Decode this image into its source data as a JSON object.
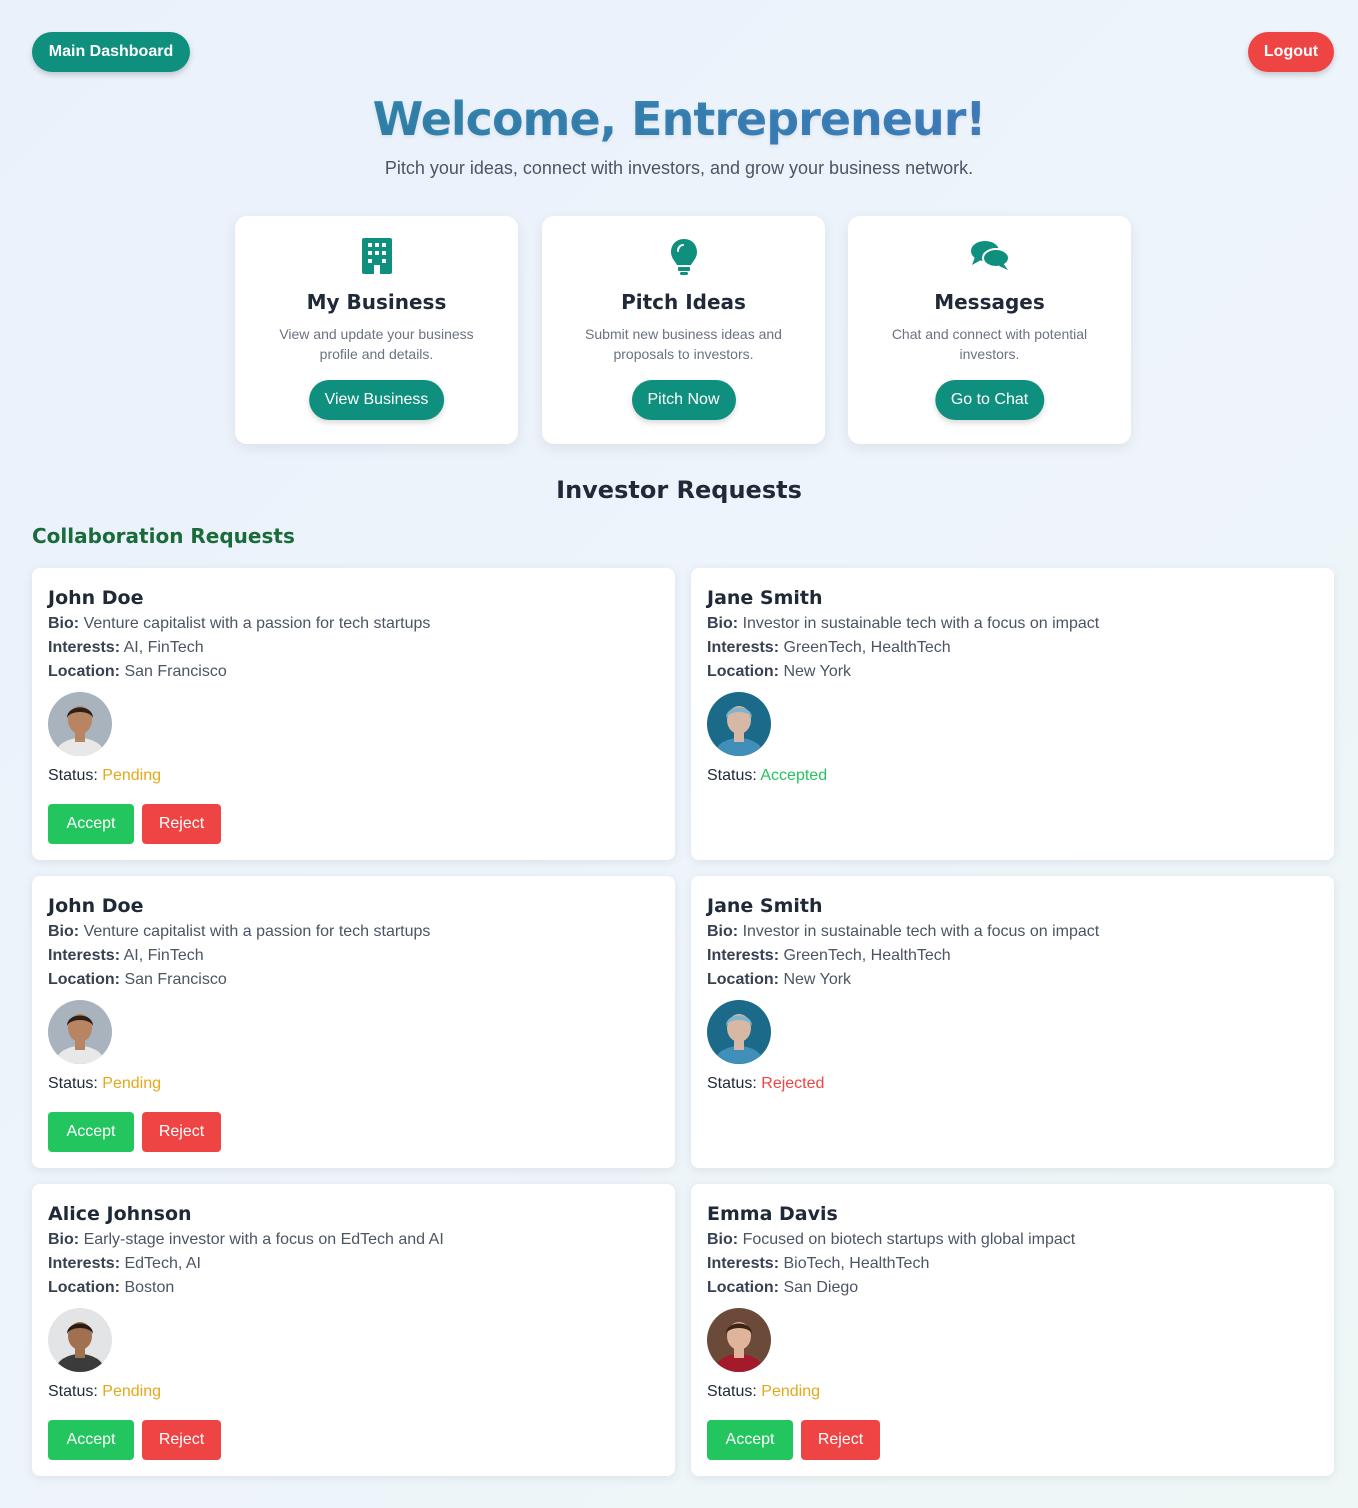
{
  "nav": {
    "dashboard_label": "Main Dashboard",
    "logout_label": "Logout"
  },
  "header": {
    "title": "Welcome, Entrepreneur!",
    "subtitle": "Pitch your ideas, connect with investors, and grow your business network."
  },
  "features": [
    {
      "icon": "building-icon",
      "title": "My Business",
      "description": "View and update your business profile and details.",
      "button": "View Business"
    },
    {
      "icon": "lightbulb-icon",
      "title": "Pitch Ideas",
      "description": "Submit new business ideas and proposals to investors.",
      "button": "Pitch Now"
    },
    {
      "icon": "chat-bubbles-icon",
      "title": "Messages",
      "description": "Chat and connect with potential investors.",
      "button": "Go to Chat"
    }
  ],
  "section_title": "Investor Requests",
  "collab_title": "Collaboration Requests",
  "labels": {
    "bio": "Bio:",
    "interests": "Interests:",
    "location": "Location:",
    "status": "Status:",
    "accept": "Accept",
    "reject": "Reject"
  },
  "requests": [
    {
      "name": "John Doe",
      "bio": "Venture capitalist with a passion for tech startups",
      "interests": "AI, FinTech",
      "location": "San Francisco",
      "status": "Pending"
    },
    {
      "name": "Jane Smith",
      "bio": "Investor in sustainable tech with a focus on impact",
      "interests": "GreenTech, HealthTech",
      "location": "New York",
      "status": "Accepted"
    },
    {
      "name": "John Doe",
      "bio": "Venture capitalist with a passion for tech startups",
      "interests": "AI, FinTech",
      "location": "San Francisco",
      "status": "Pending"
    },
    {
      "name": "Jane Smith",
      "bio": "Investor in sustainable tech with a focus on impact",
      "interests": "GreenTech, HealthTech",
      "location": "New York",
      "status": "Rejected"
    },
    {
      "name": "Alice Johnson",
      "bio": "Early-stage investor with a focus on EdTech and AI",
      "interests": "EdTech, AI",
      "location": "Boston",
      "status": "Pending"
    },
    {
      "name": "Emma Davis",
      "bio": "Focused on biotech startups with global impact",
      "interests": "BioTech, HealthTech",
      "location": "San Diego",
      "status": "Pending"
    }
  ],
  "colors": {
    "primary": "#0f8f7e",
    "danger": "#ef4444",
    "success": "#22c55e",
    "pending": "#e6a817",
    "collab_heading": "#1a6b3a"
  }
}
